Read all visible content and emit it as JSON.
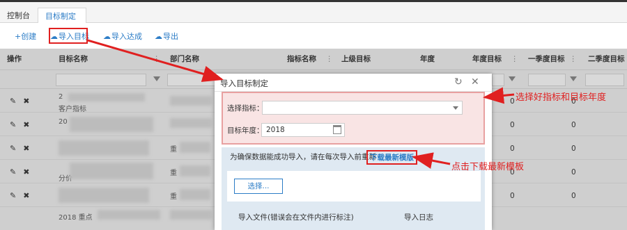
{
  "tabs": [
    {
      "label": "控制台"
    },
    {
      "label": "目标制定",
      "close": "×"
    }
  ],
  "toolbar": {
    "create": "+创建",
    "import_target": "导入目标",
    "import_achieve": "导入达成",
    "export": "导出"
  },
  "grid": {
    "headers": [
      "操作",
      "目标名称",
      "部门名称",
      "指标名称",
      "上级目标",
      "年度",
      "年度目标",
      "一季度目标",
      "二季度目标"
    ],
    "row_texts": [
      "2",
      "客户指标",
      "20",
      "分价",
      "2018 重点",
      "重",
      "重",
      "重"
    ],
    "zero": "0"
  },
  "modal": {
    "title": "导入目标制定",
    "indicator_label": "选择指标：",
    "year_label": "目标年度：",
    "year_value": "2018",
    "note": "为确保数据能成功导入，请在每次导入前重新",
    "download_link": "下载最新模版",
    "choose_button": "选择...",
    "col_file": "导入文件(错误会在文件内进行标注)",
    "col_log": "导入日志"
  },
  "annotations": {
    "select_hint": "选择好指标和目标年度",
    "download_hint": "点击下载最新模板"
  },
  "colors": {
    "accent": "#2b7cc6",
    "annotation": "#e02020"
  }
}
